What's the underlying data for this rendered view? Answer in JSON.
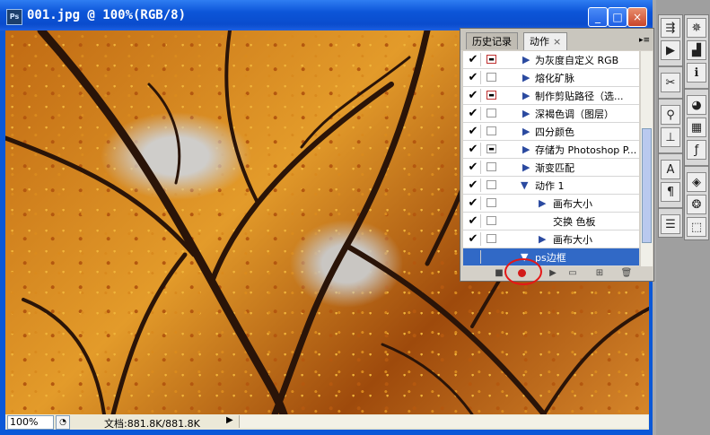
{
  "document_window": {
    "title": "001.jpg @ 100%(RGB/8)",
    "app_icon": "Ps",
    "buttons": {
      "minimize": "_",
      "maximize": "□",
      "close": "×"
    }
  },
  "status_bar": {
    "zoom": "100%",
    "doc_info": "文档:881.8K/881.8K"
  },
  "actions_panel": {
    "tabs": [
      {
        "label": "历史记录"
      },
      {
        "label": "动作"
      }
    ],
    "tab_close": "×",
    "menu_icon": "▸≡",
    "rows": [
      {
        "label": "为灰度自定义 RGB",
        "checked": "✔",
        "dialog": "red"
      },
      {
        "label": "熔化矿脉",
        "checked": "✔",
        "dialog": "none"
      },
      {
        "label": "制作剪贴路径（选...",
        "checked": "✔",
        "dialog": "red"
      },
      {
        "label": "深褐色调（图层）",
        "checked": "✔",
        "dialog": "none"
      },
      {
        "label": "四分颜色",
        "checked": "✔",
        "dialog": "none"
      },
      {
        "label": "存储为 Photoshop P...",
        "checked": "✔",
        "dialog": "black"
      },
      {
        "label": "渐变匹配",
        "checked": "✔",
        "dialog": "none"
      },
      {
        "label": "动作 1",
        "checked": "✔",
        "dialog": "none"
      },
      {
        "label": "画布大小",
        "checked": "✔",
        "dialog": "none"
      },
      {
        "label": "交换 色板",
        "checked": "✔",
        "dialog": "none"
      },
      {
        "label": "画布大小",
        "checked": "✔",
        "dialog": "none"
      },
      {
        "label": "ps边框",
        "checked": "",
        "dialog": "none"
      }
    ],
    "footer_icons": [
      "stop-icon",
      "record-icon",
      "play-icon",
      "new-set-icon",
      "new-action-icon",
      "delete-icon"
    ]
  },
  "dock": {
    "left_column": [
      "brush-preset-icon",
      "play-icon",
      "tools-icon",
      "clone-source-icon",
      "stamp-icon",
      "text-icon",
      "paragraph-icon",
      "notes-icon"
    ],
    "right_column": [
      "navigator-icon",
      "histogram-icon",
      "info-icon",
      "color-icon",
      "swatches-icon",
      "styles-icon",
      "layers-icon",
      "channels-icon",
      "paths-icon"
    ]
  },
  "colors": {
    "title_bar": "#0a58d8",
    "selection": "#3169c6",
    "record_highlight": "#e51717"
  }
}
